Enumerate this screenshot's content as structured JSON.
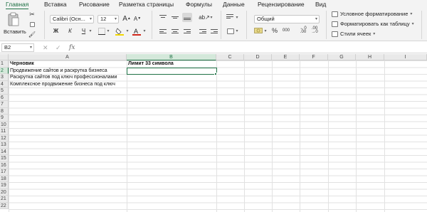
{
  "tabs": [
    {
      "label": "Главная",
      "active": true
    },
    {
      "label": "Вставка",
      "active": false
    },
    {
      "label": "Рисование",
      "active": false
    },
    {
      "label": "Разметка страницы",
      "active": false
    },
    {
      "label": "Формулы",
      "active": false
    },
    {
      "label": "Данные",
      "active": false
    },
    {
      "label": "Рецензирование",
      "active": false
    },
    {
      "label": "Вид",
      "active": false
    }
  ],
  "ribbon": {
    "paste_label": "Вставить",
    "font_name": "Calibri (Осн...",
    "font_size": "12",
    "bold": "Ж",
    "italic": "К",
    "underline": "Ч",
    "grow_font": "A",
    "shrink_font": "A",
    "number_format": "Общий",
    "percent": "%",
    "thousands": "000",
    "conditional_formatting": "Условное форматирование",
    "format_as_table": "Форматировать как таблицу",
    "cell_styles": "Стили ячеек",
    "accent_color": "#1f7145",
    "fill_color": "#f2d600",
    "font_color": "#d0271b"
  },
  "formula_bar": {
    "name_box": "B2",
    "fx": "fx",
    "cancel": "✕",
    "enter": "✓",
    "formula": ""
  },
  "columns": [
    "A",
    "B",
    "C",
    "D",
    "E",
    "F",
    "G",
    "H",
    "I"
  ],
  "rows": [
    "1",
    "2",
    "3",
    "4",
    "5",
    "6",
    "7",
    "8",
    "9",
    "10",
    "11",
    "12",
    "13",
    "14",
    "15",
    "16",
    "17",
    "18",
    "19",
    "20",
    "21",
    "22"
  ],
  "cells": {
    "A1": "Черновик",
    "B1": "Лимит 33 символа",
    "A2": "Продвижение сайтов и раскрутка бизнеса",
    "A3": "Раскрутка сайтов под ключ профессионалами",
    "A4": "Комплексное продвижение бизнеса под ключ"
  },
  "selected_cell": "B2"
}
